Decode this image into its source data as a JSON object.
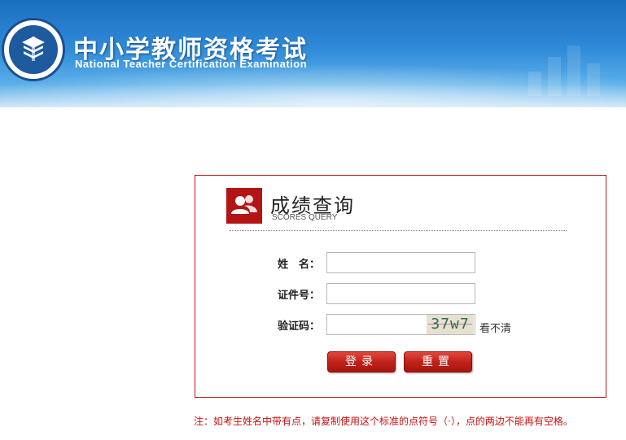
{
  "header": {
    "title_cn": "中小学教师资格考试",
    "title_en": "National Teacher Certification Examination",
    "logo_ring_text": "National Teacher Certification Examination",
    "logo_top_text": "教师资格考试"
  },
  "query": {
    "title": "成绩查询",
    "subtitle": "SCORES QUERY",
    "name_label": "姓　名：",
    "id_label": "证件号：",
    "captcha_label": "验证码：",
    "name_value": "",
    "id_value": "",
    "captcha_value": "",
    "captcha_text": "37w7",
    "refresh_label": "看不清",
    "login_label": "登录",
    "reset_label": "重置"
  },
  "notice": "注：如考生姓名中带有点，请复制使用这个标准的点符号（·），点的两边不能再有空格。",
  "colors": {
    "accent_red": "#b31515",
    "banner_blue": "#2f8ad8",
    "notice_red": "#cc1111"
  }
}
